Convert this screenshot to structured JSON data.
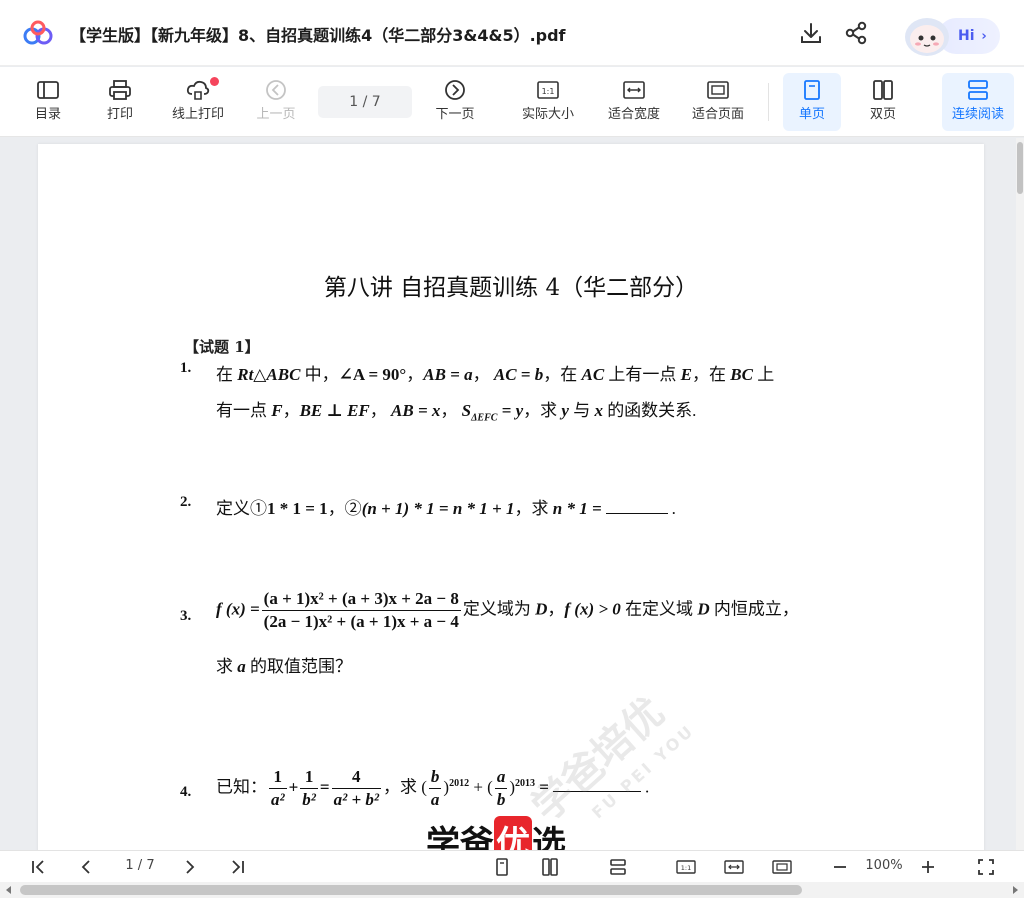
{
  "titlebar": {
    "doc_title": "【学生版】【新九年级】8、自招真题训练4（华二部分3&4&5）.pdf",
    "hi_label": "Hi",
    "brand_colors": [
      "#3c7cf5",
      "#ff5a5f",
      "#6d5cf5"
    ]
  },
  "toolbar": {
    "catalog": "目录",
    "print": "打印",
    "online_print": "线上打印",
    "prev": "上一页",
    "page_indicator": "1  /  7",
    "next": "下一页",
    "actual_size": "实际大小",
    "fit_width": "适合宽度",
    "fit_page": "适合页面",
    "single": "单页",
    "double": "双页",
    "continuous": "连续阅读",
    "accent_color": "#1677ff"
  },
  "document": {
    "heading": "第八讲  自招真题训练 4（华二部分）",
    "section": "【试题 1】",
    "q1": {
      "num": "1.",
      "l1a": "在 ",
      "l1b": "Rt△ABC",
      "l1c": " 中，",
      "l1d": "∠A = 90°",
      "l1e": "，",
      "l1f": "AB = a",
      "l1g": "，  ",
      "l1h": "AC = b",
      "l1i": "，在 ",
      "l1j": "AC",
      "l1k": " 上有一点 ",
      "l1l": "E",
      "l1m": "，在 ",
      "l1n": "BC",
      "l1o": " 上",
      "l2a": "有一点 ",
      "l2b": "F",
      "l2c": "，",
      "l2d": "BE ⊥ EF",
      "l2e": "，  ",
      "l2f": "AB = x",
      "l2g": "，  ",
      "l2h": "S",
      "l2i": "ΔEFC",
      "l2j": " = y",
      "l2k": "，求 ",
      "l2l": "y",
      "l2m": " 与 ",
      "l2n": "x",
      "l2o": " 的函数关系."
    },
    "q2": {
      "num": "2.",
      "a": "定义①",
      "b": "1 * 1 = 1",
      "c": "，②",
      "d": "(n + 1) * 1 = n * 1 + 1",
      "e": "，求 ",
      "f": "n * 1 =",
      "g": "."
    },
    "q3": {
      "num": "3.",
      "fx": "f (x) =",
      "numerator": "(a + 1)x² + (a + 3)x + 2a − 8",
      "denominator": "(2a − 1)x² + (a + 1)x + a − 4",
      "a": "定义域为 ",
      "b": "D",
      "c": "，",
      "d": "f (x) > 0",
      "e": " 在定义域 ",
      "f": "D",
      "g": " 内恒成立，",
      "l2a": "求 ",
      "l2b": "a",
      "l2c": " 的取值范围？"
    },
    "q4": {
      "num": "4.",
      "a": "已知：",
      "f1n": "1",
      "f1d": "a²",
      "plus": "+",
      "f2n": "1",
      "f2d": "b²",
      "eq": "=",
      "f3n": "4",
      "f3d": "a² + b²",
      "b": "，求 (",
      "f4n": "b",
      "f4d": "a",
      "exp1": "2012",
      "c": " + (",
      "f5n": "a",
      "f5d": "b",
      "exp2": "2013",
      "d": " =",
      "e": "."
    },
    "watermark_cn": "学爸培优",
    "watermark_en": "FU PEI YOU",
    "brand_a": "学爸",
    "brand_b": "优",
    "brand_c": "选"
  },
  "bottombar": {
    "page_indicator": "1  /  7",
    "zoom": "100%"
  }
}
